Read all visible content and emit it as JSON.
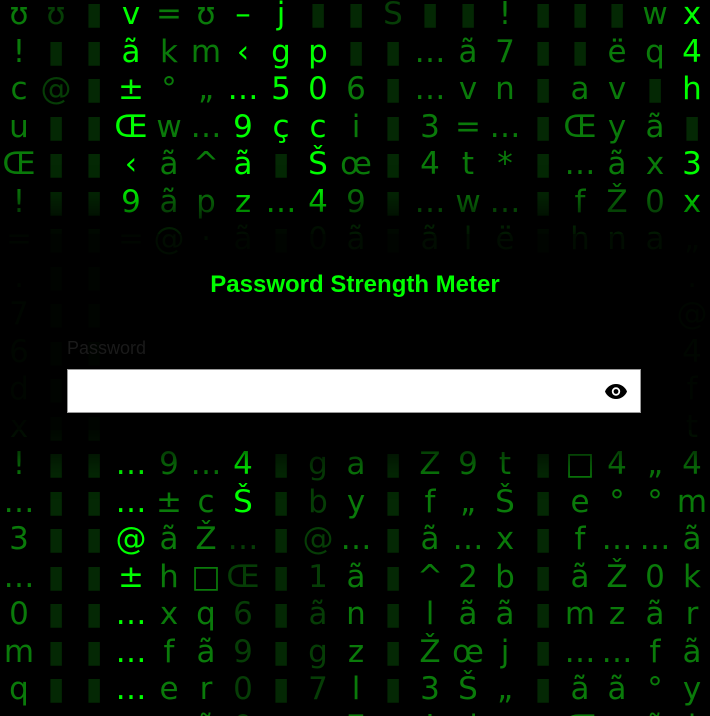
{
  "app": {
    "title": "Password Strength Meter"
  },
  "password_field": {
    "label": "Password",
    "value": "",
    "toggle_icon": "eye-icon"
  },
  "colors": {
    "accent": "#00ff00",
    "background": "#000000",
    "input_background": "#ffffff"
  },
  "matrix_rain": {
    "columns": [
      [
        "ʊ",
        "!",
        "c",
        "u",
        "Œ",
        "!",
        "=",
        ".",
        "7",
        "6",
        "d",
        "x",
        "!",
        "…",
        "3",
        "…",
        "0",
        "m",
        "q",
        "…"
      ],
      [
        "ʊ",
        "▮",
        "@",
        "▮",
        "▮",
        "▮",
        "▮",
        "▮",
        "▮",
        "▮",
        "▮",
        "▮",
        "▮",
        "▮",
        "▮",
        "▮",
        "▮",
        "▮",
        "▮",
        "▮"
      ],
      [
        "▮",
        "▮",
        "▮",
        "▮",
        "▮",
        "▮",
        "▮",
        "▮",
        "▮",
        "▮",
        "▮",
        "▮",
        "▮",
        "▮",
        "▮",
        "▮",
        "▮",
        "▮",
        "▮",
        "▮"
      ],
      [
        "v",
        "ã",
        "±",
        "Œ",
        "‹",
        "9",
        "=",
        "",
        "",
        "",
        "",
        "",
        "…",
        "…",
        "@",
        "±",
        "…",
        "…",
        "…",
        "…"
      ],
      [
        "=",
        "k",
        "°",
        "w",
        "ã",
        "ã",
        "@",
        "",
        "",
        "",
        "",
        "",
        "9",
        "±",
        "ã",
        "h",
        "x",
        "f",
        "e",
        "w"
      ],
      [
        "ʊ",
        "m",
        "„",
        "…",
        "^",
        "p",
        "·",
        "",
        "",
        "",
        "",
        "",
        "…",
        "c",
        "Ž",
        "□",
        "q",
        "ã",
        "r",
        "ã"
      ],
      [
        "–",
        "‹",
        "…",
        "9",
        "ã",
        "z",
        "ã",
        "",
        "",
        "",
        "",
        "",
        "4",
        "Š",
        "…",
        "Œ",
        "6",
        "9",
        "0",
        "0"
      ],
      [
        "j",
        "g",
        "5",
        "ç",
        "▮",
        "…",
        "▮",
        "",
        "",
        "",
        "",
        "",
        "▮",
        "▮",
        "▮",
        "▮",
        "▮",
        "▮",
        "▮",
        "▮"
      ],
      [
        "▮",
        "p",
        "0",
        "c",
        "Š",
        "4",
        "0",
        "",
        "",
        "",
        "",
        "",
        "g",
        "b",
        "@",
        "1",
        "ã",
        "g",
        "7",
        "s"
      ],
      [
        "▮",
        "▮",
        "6",
        "i",
        "œ",
        "9",
        "ã",
        "",
        "",
        "",
        "",
        "",
        "a",
        "y",
        "…",
        "ã",
        "n",
        "z",
        "l",
        "7"
      ],
      [
        "S",
        "▮",
        "▮",
        "▮",
        "▮",
        "▮",
        "▮",
        "",
        "",
        "",
        "",
        "",
        "▮",
        "▮",
        "▮",
        "▮",
        "▮",
        "▮",
        "▮",
        "▮"
      ],
      [
        "▮",
        "…",
        "…",
        "3",
        "4",
        "…",
        "ã",
        "",
        "",
        "",
        "",
        "",
        "Z",
        "f",
        "ã",
        "^",
        "l",
        "Ž",
        "3",
        "!"
      ],
      [
        "▮",
        "ã",
        "v",
        "=",
        "t",
        "w",
        "l",
        "",
        "",
        "",
        "",
        "",
        "9",
        "„",
        "…",
        "2",
        "ã",
        "œ",
        "Š",
        "d"
      ],
      [
        "!",
        "7",
        "n",
        "…",
        "*",
        "…",
        "ë",
        "",
        "",
        "",
        "",
        "",
        "t",
        "Š",
        "x",
        "b",
        "ã",
        "j",
        "„",
        "□"
      ],
      [
        "▮",
        "▮",
        "▮",
        "▮",
        "▮",
        "▮",
        "▮",
        "",
        "",
        "",
        "",
        "",
        "▮",
        "▮",
        "▮",
        "▮",
        "▮",
        "▮",
        "▮",
        "▮"
      ],
      [
        "▮",
        "▮",
        "a",
        "Œ",
        "…",
        "f",
        "h",
        "",
        "",
        "",
        "",
        "",
        "□",
        "e",
        "f",
        "ã",
        "m",
        "…",
        "ã",
        "Œ"
      ],
      [
        "▮",
        "ë",
        "v",
        "y",
        "ã",
        "Ž",
        "n",
        "",
        "",
        "",
        "",
        "",
        "4",
        "°",
        "…",
        "Ž",
        "z",
        "…",
        "ã",
        "c"
      ],
      [
        "w",
        "q",
        "▮",
        "ã",
        "x",
        "0",
        "a",
        "",
        "",
        "",
        "",
        "",
        "„",
        "°",
        "…",
        "0",
        "ã",
        "f",
        "°",
        "ã"
      ],
      [
        "x",
        "4",
        "h",
        "▮",
        "3",
        "x",
        "„",
        ".",
        "@",
        "4",
        "f",
        "t",
        "4",
        "m",
        "ã",
        "k",
        "r",
        "ã",
        "y",
        "l"
      ]
    ]
  }
}
